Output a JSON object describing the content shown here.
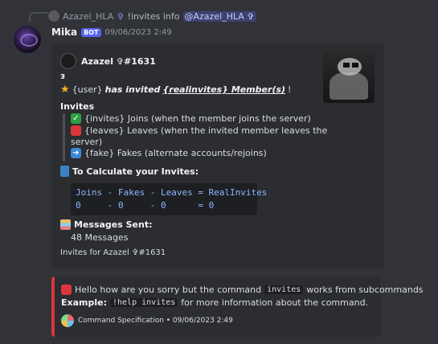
{
  "reply": {
    "author": "Azazel_HLA",
    "glyph": "✞",
    "command_text": "!invites info",
    "mention": "@Azazel_HLA ✞"
  },
  "message": {
    "username": "Mika",
    "bot_badge": "BOT",
    "timestamp": "09/06/2023 2:49"
  },
  "embed1": {
    "author": "Azazel ✞#1631",
    "small_title": "ᴈ",
    "desc_user": "{user}",
    "desc_has_invited": " has invited ",
    "desc_realinvites": "{realinvites} Member(s)",
    "desc_end": "!",
    "invites_heading": "Invites",
    "joins": "{invites} Joins (when the member joins the server)",
    "leaves_1": "{leaves} Leaves (when the invited member leaves the",
    "leaves_2": "server)",
    "fakes": "{fake} Fakes (alternate accounts/rejoins)",
    "calc_heading": "To Calculate your Invites:",
    "code_line1": "Joins - Fakes - Leaves = RealInvites",
    "code_line2": "0     - 0     - 0      = 0",
    "messages_heading": "Messages Sent:",
    "messages_value": "48 Messages",
    "footer": "Invites for Azazel ✞#1631"
  },
  "embed2": {
    "accent_color": "#da373c",
    "line1_a": "Hello how are you sorry but the command",
    "line1_code": "invites",
    "line1_b": "works from subcommands",
    "example_label": "Example:",
    "example_code": "!help invites",
    "example_rest": "for more information about the command.",
    "footer_text": "Command Specification • 09/06/2023 2:49"
  }
}
